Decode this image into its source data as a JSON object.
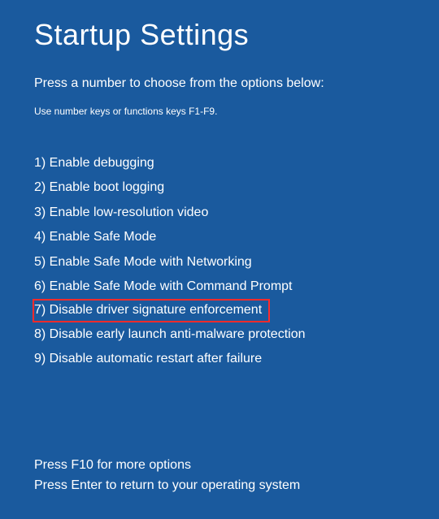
{
  "title": "Startup Settings",
  "instruction": "Press a number to choose from the options below:",
  "hint": "Use number keys or functions keys F1-F9.",
  "options": [
    {
      "label": "1) Enable debugging",
      "highlighted": false
    },
    {
      "label": "2) Enable boot logging",
      "highlighted": false
    },
    {
      "label": "3) Enable low-resolution video",
      "highlighted": false
    },
    {
      "label": "4) Enable Safe Mode",
      "highlighted": false
    },
    {
      "label": "5) Enable Safe Mode with Networking",
      "highlighted": false
    },
    {
      "label": "6) Enable Safe Mode with Command Prompt",
      "highlighted": false
    },
    {
      "label": "7) Disable driver signature enforcement",
      "highlighted": true
    },
    {
      "label": "8) Disable early launch anti-malware protection",
      "highlighted": false
    },
    {
      "label": "9) Disable automatic restart after failure",
      "highlighted": false
    }
  ],
  "footer": {
    "more_options": "Press F10 for more options",
    "return_os": "Press Enter to return to your operating system"
  },
  "colors": {
    "background": "#1a5a9e",
    "highlight_border": "#ff2b2b",
    "text": "#ffffff"
  }
}
